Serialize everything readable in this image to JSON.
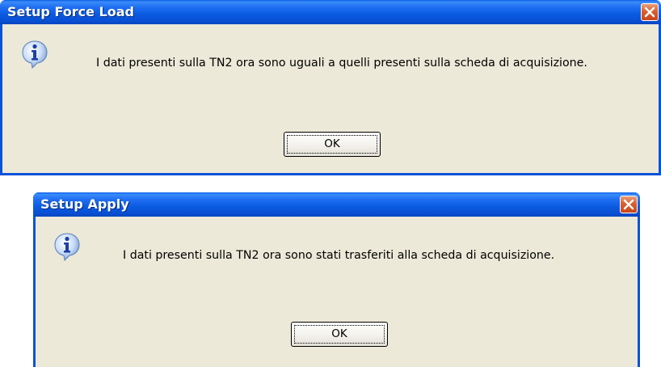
{
  "dialogs": [
    {
      "title": "Setup Force Load",
      "message": "I dati presenti sulla TN2 ora sono uguali a quelli presenti sulla scheda di acquisizione.",
      "ok_label": "OK",
      "icon": "info-icon"
    },
    {
      "title": "Setup Apply",
      "message": "I dati presenti sulla TN2 ora sono stati trasferiti alla scheda di acquisizione.",
      "ok_label": "OK",
      "icon": "info-icon"
    }
  ],
  "colors": {
    "titlebar": "#0a5ae0",
    "client": "#ece9d8",
    "close": "#d9602e"
  }
}
